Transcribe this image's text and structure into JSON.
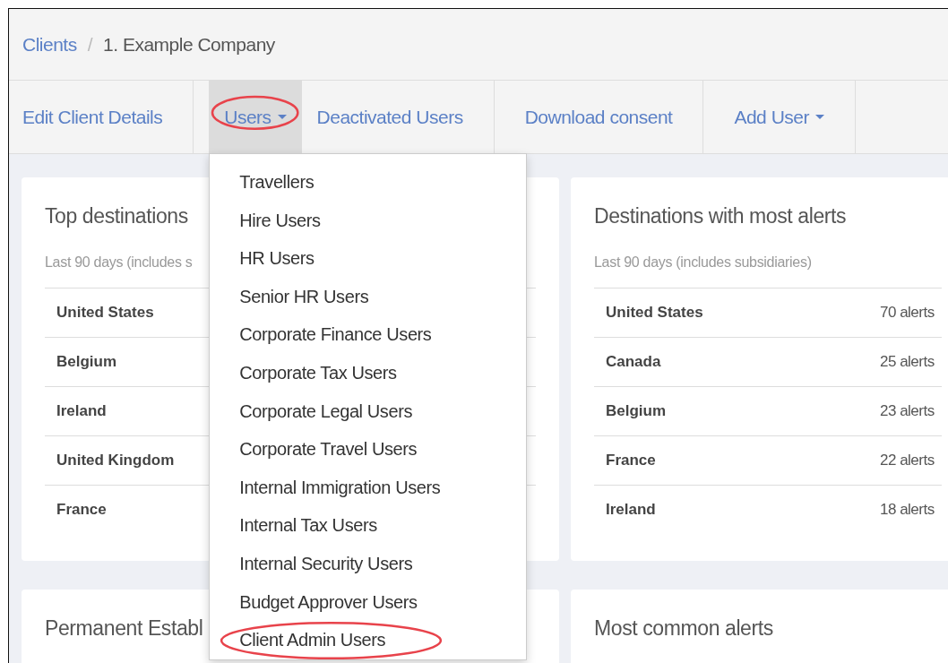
{
  "breadcrumb_separator": "/",
  "breadcrumb": [
    {
      "label": "Clients",
      "kind": "link"
    },
    {
      "label": "1. Example Company",
      "kind": "current"
    }
  ],
  "nav_groups": [
    {
      "items": [
        {
          "label": "Edit Client Details",
          "selected": false,
          "caret": false,
          "circled": false
        }
      ]
    },
    {
      "items": [
        {
          "label": "Users",
          "selected": true,
          "caret": true,
          "circled": true
        },
        {
          "label": "Deactivated Users",
          "selected": false,
          "caret": false,
          "circled": false
        }
      ]
    },
    {
      "items": [
        {
          "label": "Download consent",
          "selected": false,
          "caret": false,
          "circled": false
        }
      ]
    },
    {
      "items": [
        {
          "label": "Add User",
          "selected": false,
          "caret": true,
          "circled": false
        }
      ]
    }
  ],
  "users_menu": [
    {
      "label": "Travellers",
      "circled": false
    },
    {
      "label": "Hire Users",
      "circled": false
    },
    {
      "label": "HR Users",
      "circled": false
    },
    {
      "label": "Senior HR Users",
      "circled": false
    },
    {
      "label": "Corporate Finance Users",
      "circled": false
    },
    {
      "label": "Corporate Tax Users",
      "circled": false
    },
    {
      "label": "Corporate Legal Users",
      "circled": false
    },
    {
      "label": "Corporate Travel Users",
      "circled": false
    },
    {
      "label": "Internal Immigration Users",
      "circled": false
    },
    {
      "label": "Internal Tax Users",
      "circled": false
    },
    {
      "label": "Internal Security Users",
      "circled": false
    },
    {
      "label": "Budget Approver Users",
      "circled": false
    },
    {
      "label": "Client Admin Users",
      "circled": true
    }
  ],
  "cards": [
    {
      "title": "Top destinations",
      "subtitle": "Last 90 days (includes s",
      "rows": [
        {
          "name": "United States"
        },
        {
          "name": "Belgium"
        },
        {
          "name": "Ireland"
        },
        {
          "name": "United Kingdom"
        },
        {
          "name": "France"
        }
      ]
    },
    {
      "title": "Destinations with most alerts",
      "subtitle": "Last 90 days (includes subsidiaries)",
      "rows": [
        {
          "name": "United States",
          "value": "70 alerts"
        },
        {
          "name": "Canada",
          "value": "25 alerts"
        },
        {
          "name": "Belgium",
          "value": "23 alerts"
        },
        {
          "name": "France",
          "value": "22 alerts"
        },
        {
          "name": "Ireland",
          "value": "18 alerts"
        }
      ]
    },
    {
      "title": "Permanent Establ"
    },
    {
      "title": "Most common alerts"
    }
  ]
}
